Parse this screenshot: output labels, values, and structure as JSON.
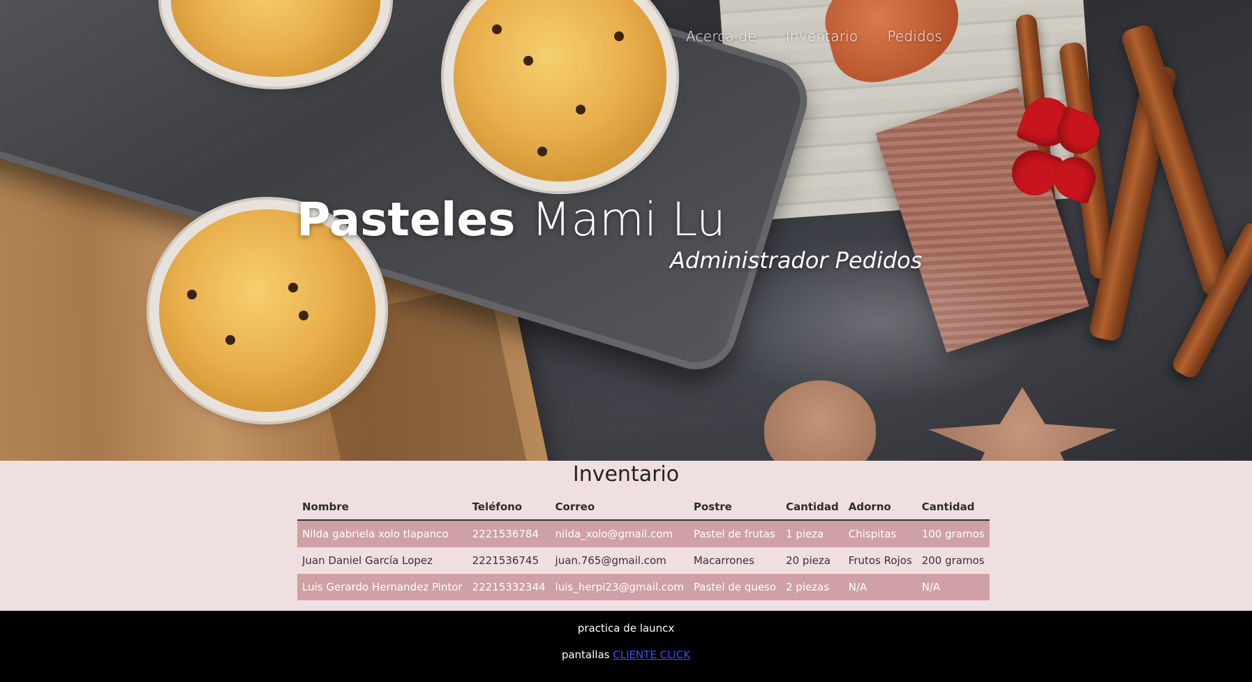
{
  "nav": {
    "items": [
      {
        "label": "Acerca de"
      },
      {
        "label": "Inventario"
      },
      {
        "label": "Pedidos"
      }
    ]
  },
  "hero": {
    "title_bold": "Pasteles",
    "title_light": "Mami Lu",
    "subtitle": "Administrador Pedidos",
    "background_image": "bakery-muffins-cinnamon-photo"
  },
  "inventory": {
    "heading": "Inventario",
    "columns": [
      "Nombre",
      "Teléfono",
      "Correo",
      "Postre",
      "Cantidad",
      "Adorno",
      "Cantidad"
    ],
    "rows": [
      [
        "Nilda gabriela xolo tlapanco",
        "2221536784",
        "nilda_xolo@gmail.com",
        "Pastel de frutas",
        "1 pieza",
        "Chispitas",
        "100 gramos"
      ],
      [
        "Juan Daniel García Lopez",
        "2221536745",
        "juan.765@gmail.com",
        "Macarrones",
        "20 pieza",
        "Frutos Rojos",
        "200 gramos"
      ],
      [
        "Luis Gerardo Hernandez Pintor",
        "22215332344",
        "luis_herpi23@gmail.com",
        "Pastel de queso",
        "2 piezas",
        "N/A",
        "N/A"
      ]
    ]
  },
  "footer": {
    "line1": "practica de launcx",
    "line2_prefix": "pantallas",
    "link_label": "CLIENTE CLICK"
  },
  "colors": {
    "section_bg": "#f0dfe0",
    "row_highlight": "#cfa0a5",
    "footer_bg": "#000000",
    "link": "#3d4bff"
  }
}
